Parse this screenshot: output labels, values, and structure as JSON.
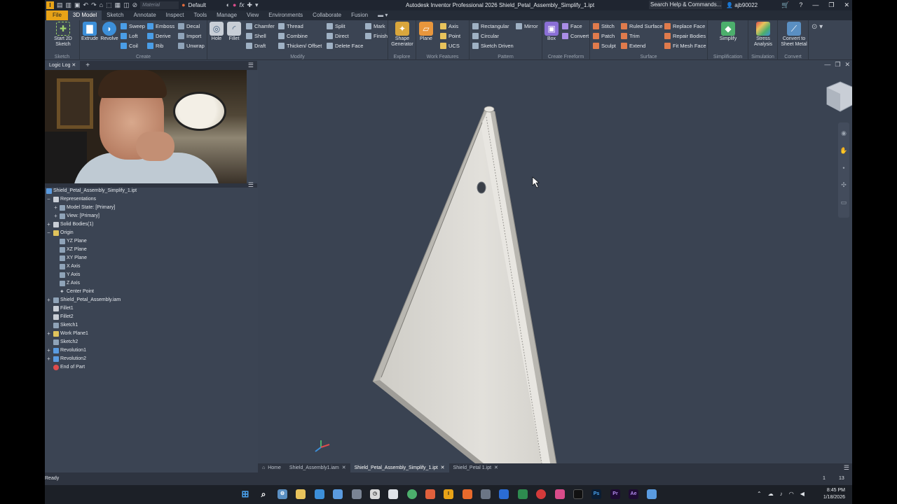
{
  "app": {
    "title": "Autodesk Inventor Professional 2026   Shield_Petal_Assembly_Simplify_1.ipt",
    "material_placeholder": "Material",
    "appearance": "Default",
    "search_placeholder": "Search Help & Commands...",
    "user": "ajb90022"
  },
  "tabs": [
    "File",
    "3D Model",
    "Sketch",
    "Annotate",
    "Inspect",
    "Tools",
    "Manage",
    "View",
    "Environments",
    "Collaborate",
    "Fusion"
  ],
  "ribbon": {
    "sketch": {
      "name": "Sketch",
      "start": "Start 2D Sketch"
    },
    "create": {
      "name": "Create",
      "extrude": "Extrude",
      "revolve": "Revolve",
      "sweep": "Sweep",
      "loft": "Loft",
      "coil": "Coil",
      "emboss": "Emboss",
      "derive": "Derive",
      "rib": "Rib",
      "decal": "Decal",
      "import": "Import",
      "unwrap": "Unwrap"
    },
    "modify": {
      "name": "Modify",
      "hole": "Hole",
      "fillet": "Fillet",
      "chamfer": "Chamfer",
      "shell": "Shell",
      "draft": "Draft",
      "thread": "Thread",
      "combine": "Combine",
      "thicken": "Thicken/ Offset",
      "split": "Split",
      "direct": "Direct",
      "delete_face": "Delete Face",
      "mark": "Mark",
      "finish": "Finish"
    },
    "explore": {
      "name": "Explore",
      "shape_gen": "Shape Generator"
    },
    "work": {
      "name": "Work Features",
      "plane": "Plane",
      "axis": "Axis",
      "point": "Point",
      "ucs": "UCS"
    },
    "pattern": {
      "name": "Pattern",
      "rect": "Rectangular",
      "circ": "Circular",
      "sketch_driven": "Sketch Driven",
      "mirror": "Mirror"
    },
    "freeform": {
      "name": "Create Freeform",
      "box": "Box",
      "face": "Face",
      "convert": "Convert"
    },
    "surface": {
      "name": "Surface",
      "stitch": "Stitch",
      "patch": "Patch",
      "sculpt": "Sculpt",
      "ruled": "Ruled Surface",
      "trim": "Trim",
      "extend": "Extend",
      "replace": "Replace Face",
      "repair": "Repair Bodies",
      "fitmesh": "Fit Mesh Face"
    },
    "simplification": {
      "name": "Simplification",
      "simplify": "Simplify"
    },
    "simulation": {
      "name": "Simulation",
      "stress": "Stress Analysis"
    },
    "convert": {
      "name": "Convert",
      "sheet": "Convert to Sheet Metal"
    }
  },
  "left_panel": {
    "tab": "Logic Log"
  },
  "browser": {
    "root": "Shield_Petal_Assembly_Simplify_1.ipt",
    "rows": [
      {
        "label": "Representations"
      },
      {
        "label": "Model State: [Primary]"
      },
      {
        "label": "View: [Primary]"
      },
      {
        "label": "Solid Bodies(1)"
      },
      {
        "label": "Origin"
      },
      {
        "label": "YZ Plane"
      },
      {
        "label": "XZ Plane"
      },
      {
        "label": "XY Plane"
      },
      {
        "label": "X Axis"
      },
      {
        "label": "Y Axis"
      },
      {
        "label": "Z Axis"
      },
      {
        "label": "Center Point"
      },
      {
        "label": "Shield_Petal_Assembly.iam"
      },
      {
        "label": "Fillet1"
      },
      {
        "label": "Fillet2"
      },
      {
        "label": "Sketch1"
      },
      {
        "label": "Work Plane1"
      },
      {
        "label": "Sketch2"
      },
      {
        "label": "Revolution1"
      },
      {
        "label": "Revolution2"
      },
      {
        "label": "End of Part"
      }
    ]
  },
  "doc_tabs": {
    "home": "Home",
    "items": [
      "Shield_Assembly1.iam",
      "Shield_Petal_Assembly_Simplify_1.ipt",
      "Shield_Petal 1.ipt"
    ]
  },
  "status": {
    "text": "Ready",
    "n1": "1",
    "n2": "13"
  },
  "taskbar": {
    "time": "8:45 PM",
    "date": "1/18/2026"
  },
  "colors": {
    "accent": "#e8a317",
    "ribbon_bg": "#3b4453",
    "viewport_bg": "#3a4352"
  }
}
